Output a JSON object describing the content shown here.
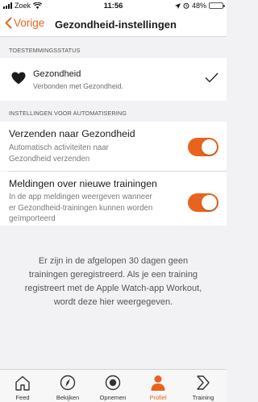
{
  "status_bar": {
    "carrier": "Zoek",
    "time": "11:56",
    "battery_percent": "48%",
    "battery_level": 0.48
  },
  "nav": {
    "back_label": "Vorige",
    "title": "Gezondheid-instellingen"
  },
  "permission_section": {
    "header": "TOESTEMMINGSSTATUS",
    "title": "Gezondheid",
    "subtitle": "Verbonden met Gezondheid.",
    "checked": true
  },
  "automation_section": {
    "header": "INSTELLINGEN VOOR AUTOMATISERING",
    "rows": [
      {
        "title": "Verzenden naar Gezondheid",
        "desc_line1": "Automatisch activiteiten naar",
        "desc_line2": "Gezondheid verzenden",
        "enabled": true
      },
      {
        "title": "Meldingen over nieuwe trainingen",
        "desc_line1": "In de app meldingen weergeven wanneer",
        "desc_line2": "er Gezondheid-trainingen kunnen worden",
        "desc_line3": "geïmporteerd",
        "enabled": true
      }
    ]
  },
  "info": {
    "line1": "Er zijn in de afgelopen 30 dagen geen",
    "line2": "trainingen geregistreerd. Als je een training",
    "line3": "registreert met de Apple Watch-app Workout,",
    "line4": "wordt deze hier weergegeven."
  },
  "tabs": [
    {
      "label": "Feed",
      "icon": "home-icon",
      "active": false
    },
    {
      "label": "Bekijken",
      "icon": "compass-icon",
      "active": false
    },
    {
      "label": "Opnemen",
      "icon": "record-icon",
      "active": false
    },
    {
      "label": "Profiel",
      "icon": "person-icon",
      "active": true
    },
    {
      "label": "Training",
      "icon": "chevron-right-icon",
      "active": false
    }
  ],
  "colors": {
    "accent": "#e8641e",
    "background": "#f2f2f4"
  }
}
